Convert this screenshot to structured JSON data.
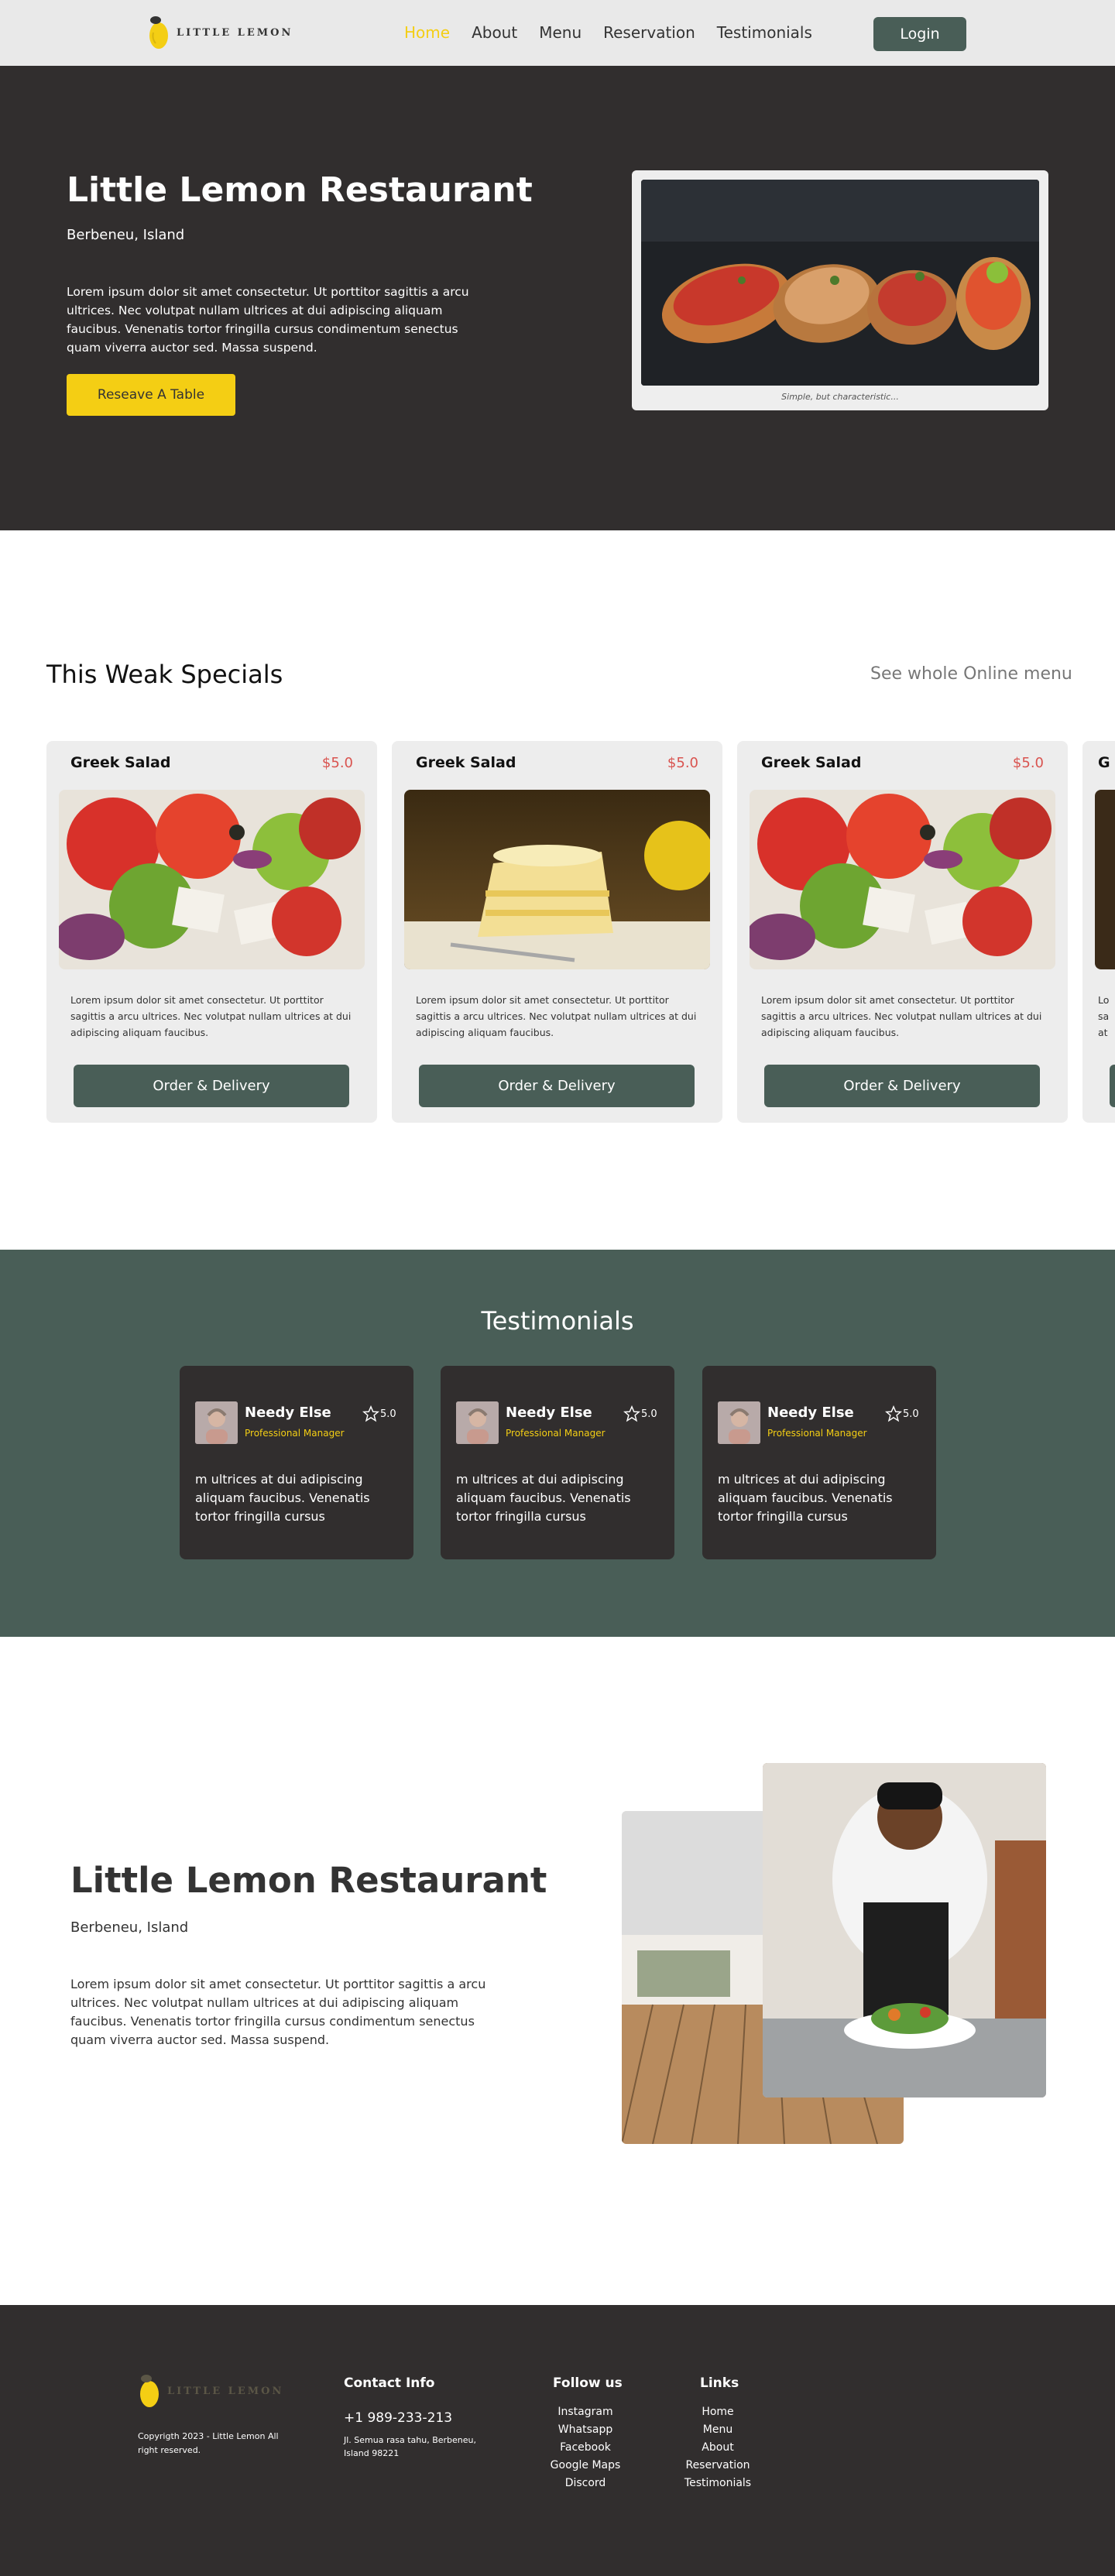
{
  "nav": {
    "brand": "LITTLE LEMON",
    "links": [
      "Home",
      "About",
      "Menu",
      "Reservation",
      "Testimonials"
    ],
    "login_label": "Login"
  },
  "hero": {
    "title": "Little Lemon Restaurant",
    "subtitle": "Berbeneu, Island",
    "description": "Lorem ipsum dolor sit amet consectetur. Ut porttitor sagittis a arcu ultrices. Nec volutpat nullam ultrices at dui adipiscing aliquam faucibus. Venenatis tortor fringilla cursus condimentum senectus quam viverra auctor sed. Massa suspend.",
    "button_label": "Reseave A Table",
    "image_caption": "Simple, but characteristic..."
  },
  "specials": {
    "title": "This Weak Specials",
    "link_label": "See whole Online menu",
    "cards": [
      {
        "name": "Greek Salad",
        "price": "$5.0",
        "description": "Lorem ipsum dolor sit amet consectetur. Ut porttitor sagittis a arcu ultrices. Nec volutpat nullam ultrices at dui adipiscing aliquam faucibus.",
        "button_label": "Order & Delivery",
        "image": "salad"
      },
      {
        "name": "Greek Salad",
        "price": "$5.0",
        "description": "Lorem ipsum dolor sit amet consectetur. Ut porttitor sagittis a arcu ultrices. Nec volutpat nullam ultrices at dui adipiscing aliquam faucibus.",
        "button_label": "Order & Delivery",
        "image": "lemon-cake"
      },
      {
        "name": "Greek Salad",
        "price": "$5.0",
        "description": "Lorem ipsum dolor sit amet consectetur. Ut porttitor sagittis a arcu ultrices. Nec volutpat nullam ultrices at dui adipiscing aliquam faucibus.",
        "button_label": "Order & Delivery",
        "image": "salad"
      },
      {
        "name": "G",
        "price": "",
        "description": "Lo sa at",
        "button_label": "",
        "image": "partial"
      }
    ]
  },
  "testimonials": {
    "title": "Testimonials",
    "items": [
      {
        "name": "Needy Else",
        "role": "Professional Manager",
        "rating": "5.0",
        "quote": "m ultrices at dui adipiscing aliquam faucibus. Venenatis tortor fringilla cursus"
      },
      {
        "name": "Needy Else",
        "role": "Professional Manager",
        "rating": "5.0",
        "quote": "m ultrices at dui adipiscing aliquam faucibus. Venenatis tortor fringilla cursus"
      },
      {
        "name": "Needy Else",
        "role": "Professional Manager",
        "rating": "5.0",
        "quote": "m ultrices at dui adipiscing aliquam faucibus. Venenatis tortor fringilla cursus"
      }
    ]
  },
  "about": {
    "title": "Little Lemon Restaurant",
    "subtitle": "Berbeneu, Island",
    "description": "Lorem ipsum dolor sit amet consectetur. Ut porttitor sagittis a arcu ultrices. Nec volutpat nullam ultrices at dui adipiscing aliquam faucibus. Venenatis tortor fringilla cursus condimentum senectus quam viverra auctor sed. Massa suspend."
  },
  "footer": {
    "brand": "LITTLE LEMON",
    "copyright": "Copyrigth 2023 - Little Lemon All right reserved.",
    "contact_title": "Contact Info",
    "phone": "+1 989-233-213",
    "address": "Jl. Semua rasa tahu, Berbeneu, Island 98221",
    "follow_title": "Follow us",
    "follow_links": [
      "Instagram",
      "Whatsapp",
      "Facebook",
      "Google Maps",
      "Discord"
    ],
    "links_title": "Links",
    "links": [
      "Home",
      "Menu",
      "About",
      "Reservation",
      "Testimonials"
    ]
  },
  "colors": {
    "primary_green": "#495e57",
    "primary_yellow": "#f4ce14",
    "dark": "#312e2e",
    "price_red": "#d9534f"
  }
}
